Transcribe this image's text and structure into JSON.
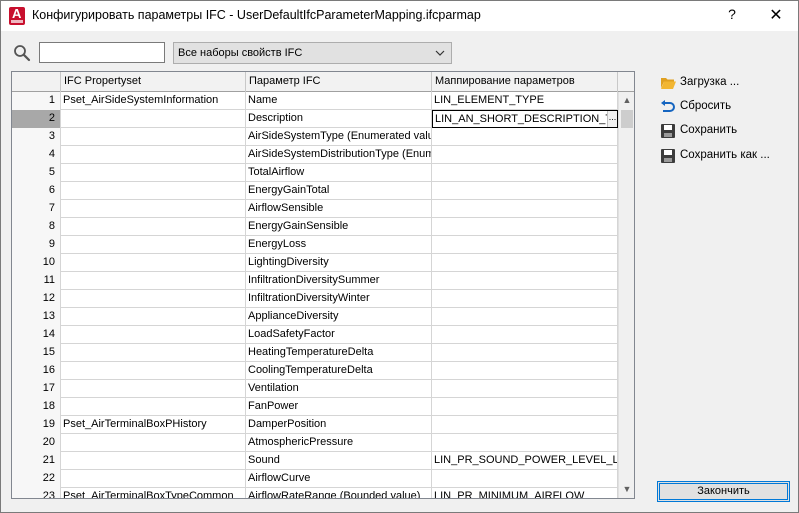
{
  "window": {
    "title": "Конфигурировать параметры IFC - UserDefaultIfcParameterMapping.ifcparmap",
    "help_label": "?",
    "close_label": "✕"
  },
  "search": {
    "value": "",
    "placeholder": ""
  },
  "filter": {
    "selected": "Все наборы свойств IFC"
  },
  "grid": {
    "columns": [
      "",
      "IFC Propertyset",
      "Параметр IFC",
      "Маппирование параметров"
    ],
    "rows": [
      {
        "n": "1",
        "pset": "Pset_AirSideSystemInformation",
        "param": "Name",
        "map": "LIN_ELEMENT_TYPE"
      },
      {
        "n": "2",
        "pset": "",
        "param": "Description",
        "map": "LIN_AN_SHORT_DESCRIPTION_TEXT"
      },
      {
        "n": "3",
        "pset": "",
        "param": "AirSideSystemType (Enumerated value)",
        "map": ""
      },
      {
        "n": "4",
        "pset": "",
        "param": "AirSideSystemDistributionType (Enumerated value)",
        "map": ""
      },
      {
        "n": "5",
        "pset": "",
        "param": "TotalAirflow",
        "map": ""
      },
      {
        "n": "6",
        "pset": "",
        "param": "EnergyGainTotal",
        "map": ""
      },
      {
        "n": "7",
        "pset": "",
        "param": "AirflowSensible",
        "map": ""
      },
      {
        "n": "8",
        "pset": "",
        "param": "EnergyGainSensible",
        "map": ""
      },
      {
        "n": "9",
        "pset": "",
        "param": "EnergyLoss",
        "map": ""
      },
      {
        "n": "10",
        "pset": "",
        "param": "LightingDiversity",
        "map": ""
      },
      {
        "n": "11",
        "pset": "",
        "param": "InfiltrationDiversitySummer",
        "map": ""
      },
      {
        "n": "12",
        "pset": "",
        "param": "InfiltrationDiversityWinter",
        "map": ""
      },
      {
        "n": "13",
        "pset": "",
        "param": "ApplianceDiversity",
        "map": ""
      },
      {
        "n": "14",
        "pset": "",
        "param": "LoadSafetyFactor",
        "map": ""
      },
      {
        "n": "15",
        "pset": "",
        "param": "HeatingTemperatureDelta",
        "map": ""
      },
      {
        "n": "16",
        "pset": "",
        "param": "CoolingTemperatureDelta",
        "map": ""
      },
      {
        "n": "17",
        "pset": "",
        "param": "Ventilation",
        "map": ""
      },
      {
        "n": "18",
        "pset": "",
        "param": "FanPower",
        "map": ""
      },
      {
        "n": "19",
        "pset": "Pset_AirTerminalBoxPHistory",
        "param": "DamperPosition",
        "map": ""
      },
      {
        "n": "20",
        "pset": "",
        "param": "AtmosphericPressure",
        "map": ""
      },
      {
        "n": "21",
        "pset": "",
        "param": "Sound",
        "map": "LIN_PR_SOUND_POWER_LEVEL_LW"
      },
      {
        "n": "22",
        "pset": "",
        "param": "AirflowCurve",
        "map": ""
      },
      {
        "n": "23",
        "pset": "Pset_AirTerminalBoxTypeCommon",
        "param": "AirflowRateRange (Bounded value)",
        "map": "LIN_PR_MINIMUM_AIRFLOW"
      }
    ],
    "editing_ellipsis": "..."
  },
  "actions": {
    "load": "Загрузка ...",
    "reset": "Сбросить",
    "save": "Сохранить",
    "save_as": "Сохранить как ...",
    "finish": "Закончить"
  },
  "colors": {
    "accent": "#0078d7",
    "app_icon": "#c8102e",
    "folder": "#f2b632",
    "reset_arrow": "#1565c0"
  }
}
